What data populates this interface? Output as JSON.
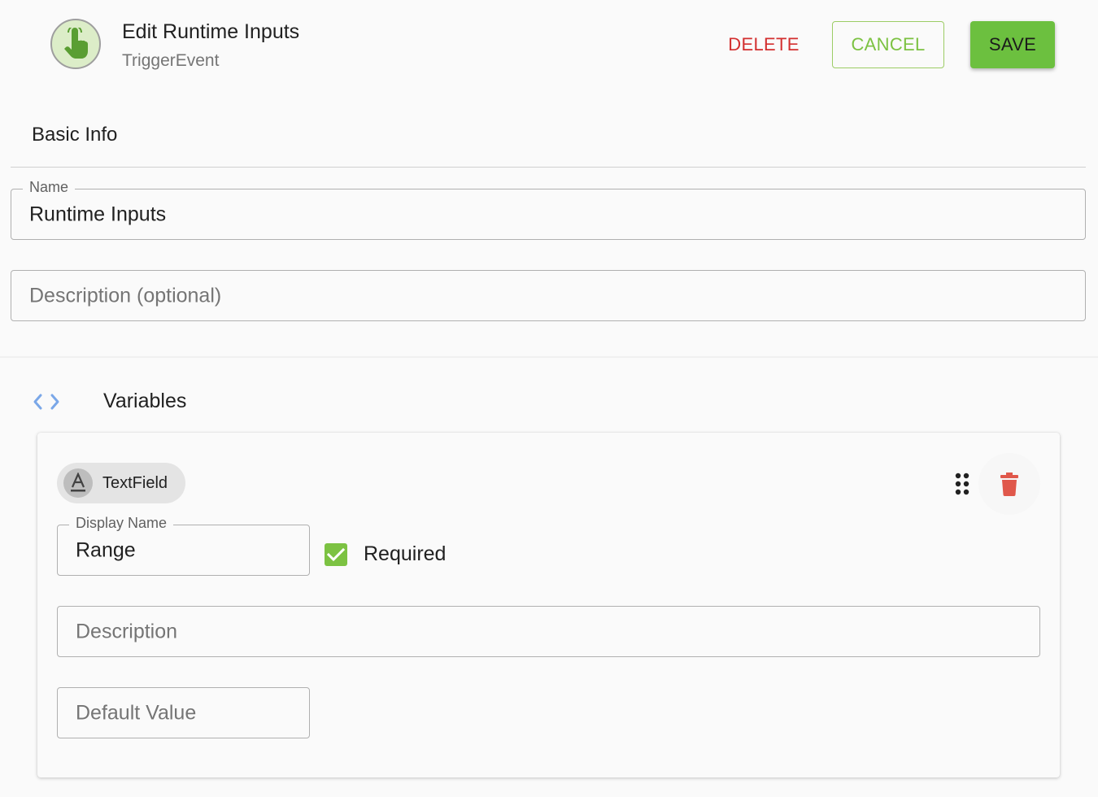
{
  "header": {
    "title": "Edit Runtime Inputs",
    "subtitle": "TriggerEvent",
    "icon": "touch-app-icon",
    "delete_label": "DELETE",
    "cancel_label": "CANCEL",
    "save_label": "SAVE"
  },
  "basic_info": {
    "section_title": "Basic Info",
    "name": {
      "label": "Name",
      "value": "Runtime Inputs"
    },
    "description": {
      "placeholder": "Description (optional)"
    }
  },
  "variables": {
    "section_title": "Variables",
    "icon": "code-icon",
    "items": [
      {
        "type_label": "TextField",
        "type_icon": "text-format-icon",
        "display_name": {
          "label": "Display Name",
          "value": "Range"
        },
        "required": {
          "label": "Required",
          "checked": true
        },
        "description": {
          "placeholder": "Description"
        },
        "default_value": {
          "placeholder": "Default Value"
        }
      }
    ]
  },
  "colors": {
    "accent_green": "#6cc03f",
    "delete_red": "#d32f2f",
    "trash_red": "#e0584b",
    "code_icon_blue": "#7aa7e8"
  }
}
